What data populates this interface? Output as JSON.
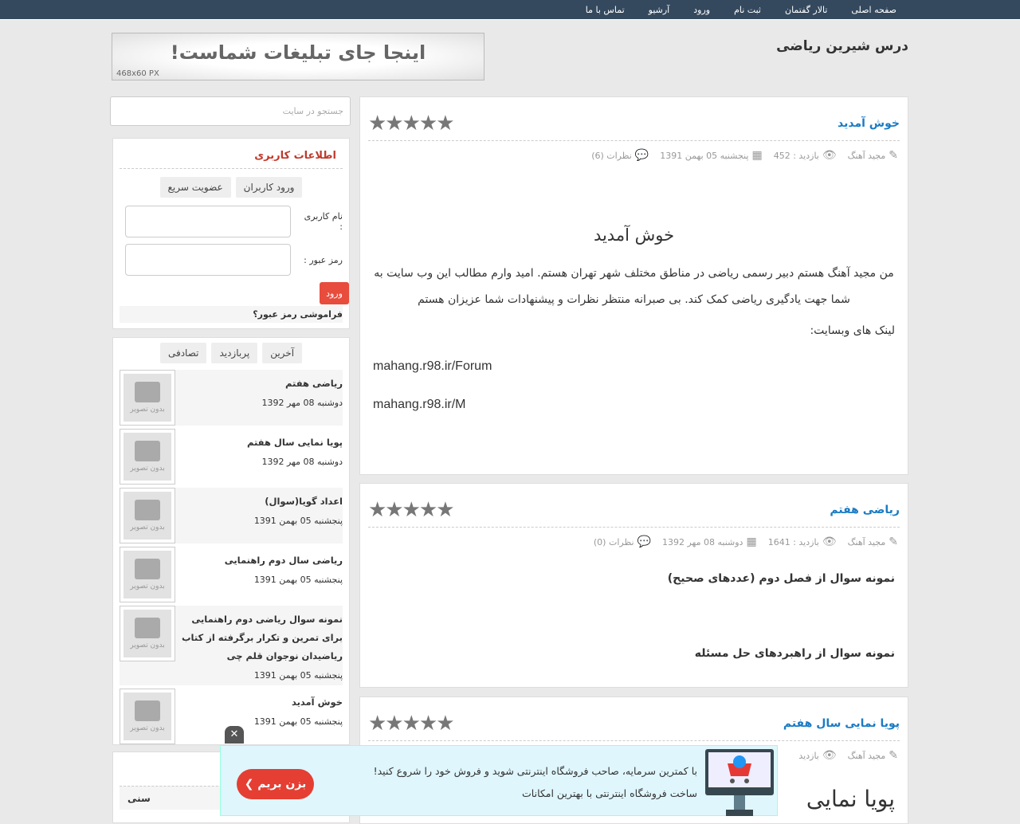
{
  "nav": [
    "صفحه اصلی",
    "تالار گفتمان",
    "ثبت نام",
    "ورود",
    "آرشیو",
    "تماس با ما"
  ],
  "site_title": "درس شیرین ریاضی",
  "ad": {
    "text": "اینجا جای تبلیغات شماست!",
    "size": "468x60   PX"
  },
  "search": {
    "placeholder": "جستجو در سایت"
  },
  "user_box": {
    "title": "اطلاعات کاربری",
    "tabs": [
      "ورود کاربران",
      "عضویت سریع"
    ],
    "username_label": "نام کاربری :",
    "password_label": "رمز عبور :",
    "login": "ورود",
    "forgot": "فراموشی رمز عبور؟"
  },
  "posts_box": {
    "tabs": [
      "آخرین",
      "پربازدید",
      "تصادفی"
    ],
    "no_image": "بدون تصویر",
    "items": [
      {
        "title": "ریاضی هفتم",
        "date": "دوشنبه 08 مهر 1392"
      },
      {
        "title": "پویا نمایی سال هفتم",
        "date": "دوشنبه 08 مهر 1392"
      },
      {
        "title": "اعداد گویا(سوال)",
        "date": "پنجشنبه 05 بهمن 1391"
      },
      {
        "title": "ریاضی سال دوم راهنمایی",
        "date": "پنجشنبه 05 بهمن 1391"
      },
      {
        "title": "نمونه سوال ریاضی دوم راهنمایی برای تمرین و تکرار برگرفته از کتاب ریاضیدان نوجوان قلم چی",
        "date": "پنجشنبه 05 بهمن 1391"
      },
      {
        "title": "خوش آمدید",
        "date": "پنجشنبه 05 بهمن 1391"
      }
    ]
  },
  "bottom_box": {
    "partial_text": "سنی"
  },
  "posts": [
    {
      "title": "خوش آمدید",
      "author": "مجید آهنگ",
      "views": "بازدید : 452",
      "date": "پنجشنبه 05 بهمن 1391",
      "comments": "نظرات (6)",
      "rating": 5,
      "heading": "خوش آمدید",
      "body": "من مجید آهنگ هستم دبیر رسمی ریاضی در مناطق مختلف شهر تهران هستم. امید وارم مطالب این وب سایت به شما جهت یادگیری ریاضی کمک کند. بی صبرانه منتظر نظرات و پیشنهادات شما عزیزان هستم",
      "links_label": "لینک های وبسایت:",
      "links": [
        "mahang.r98.ir/Forum",
        "mahang.r98.ir/M"
      ]
    },
    {
      "title": "ریاضی هفتم",
      "author": "مجید آهنگ",
      "views": "بازدید : 1641",
      "date": "دوشنبه 08 مهر 1392",
      "comments": "نظرات (0)",
      "rating": 5,
      "lines": [
        "نمونه سوال از فصل دوم (عددهای صحیح)",
        "نمونه سوال از راهبردهای حل مسئله"
      ]
    },
    {
      "title": "پویا نمایی سال هفتم",
      "author": "مجید آهنگ",
      "views": "بازدید",
      "heading": "پویا نمایی",
      "rating": 5
    }
  ],
  "promo": {
    "line1": "با کمترین سرمایه، صاحب فروشگاه اینترنتی شوید و فروش خود را شروع کنید!",
    "line2": "ساخت فروشگاه اینترنتی با بهترین امکانات",
    "button": "بزن بریم ❯",
    "close": "✕"
  }
}
